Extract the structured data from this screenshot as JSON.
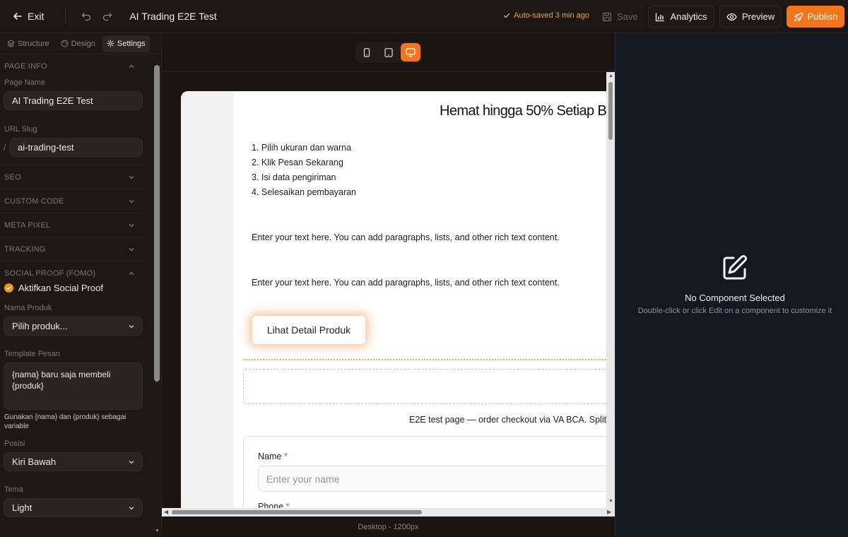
{
  "topbar": {
    "exit_label": "Exit",
    "page_title": "AI Trading E2E Test",
    "autosave": "Auto-saved 3 min ago",
    "save_label": "Save",
    "analytics_label": "Analytics",
    "preview_label": "Preview",
    "publish_label": "Publish"
  },
  "left_panel": {
    "tabs": [
      {
        "label": "Structure",
        "icon": "layers-icon"
      },
      {
        "label": "Design",
        "icon": "palette-icon"
      },
      {
        "label": "Settings",
        "icon": "gear-icon",
        "active": true
      }
    ],
    "page_info": {
      "header": "PAGE INFO",
      "page_name_label": "Page Name",
      "page_name_value": "AI Trading E2E Test",
      "url_slug_label": "URL Slug",
      "url_slug_prefix": "/",
      "url_slug_value": "ai-trading-test"
    },
    "sections": [
      "SEO",
      "CUSTOM CODE",
      "META PIXEL",
      "TRACKING"
    ],
    "social_proof": {
      "header": "SOCIAL PROOF (FOMO)",
      "enable_label": "Aktifkan Social Proof",
      "enabled": true,
      "product_label": "Nama Produk",
      "product_value": "Pilih produk...",
      "template_label": "Template Pesan",
      "template_value": "{nama} baru saja membeli {produk}",
      "template_hint": "Gunakan {nama} dan {produk} sebagai variable",
      "position_label": "Posisi",
      "position_value": "Kiri Bawah",
      "theme_label": "Tema",
      "theme_value": "Light"
    }
  },
  "devices": [
    {
      "name": "mobile",
      "icon": "mobile-icon"
    },
    {
      "name": "tablet",
      "icon": "tablet-icon"
    },
    {
      "name": "desktop",
      "icon": "desktop-icon",
      "active": true
    }
  ],
  "canvas": {
    "headline": "Hemat hingga 50% Setiap B",
    "steps": [
      "1. Pilih ukuran dan warna",
      "2. Klik Pesan Sekarang",
      "3. Isi data pengiriman",
      "4. Selesaikan pembayaran"
    ],
    "richtext_1": "Enter your text here. You can add paragraphs, lists, and other rich text content.",
    "richtext_2": "Enter your text here. You can add paragraphs, lists, and other rich text content.",
    "cta_label": "Lihat Detail Produk",
    "footer_note": "E2E test page — order checkout via VA BCA. Split",
    "form": {
      "name_label": "Name",
      "name_placeholder": "Enter your name",
      "phone_label": "Phone",
      "required_mark": "*"
    },
    "device_caption": "Desktop - 1200px"
  },
  "right_panel": {
    "empty_title": "No Component Selected",
    "empty_subtitle": "Double-click or click Edit on a component to customize it"
  },
  "colors": {
    "accent": "#f2761d",
    "autosave": "#e8a24a",
    "panel_bg": "#1d1815",
    "right_bg": "#131822"
  }
}
